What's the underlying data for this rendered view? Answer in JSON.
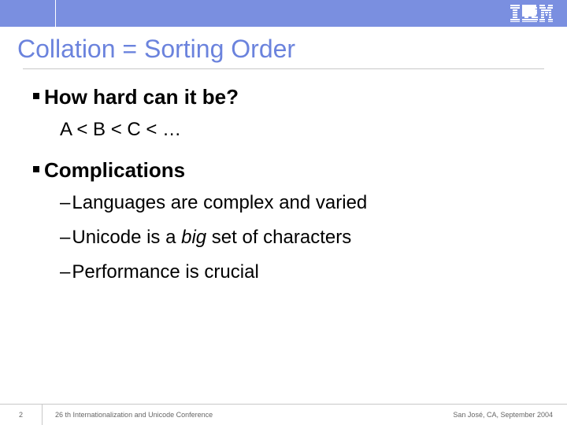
{
  "header": {
    "logo_name": "ibm-logo"
  },
  "title": "Collation = Sorting Order",
  "bullets": {
    "b1": {
      "heading": "How hard can it be?",
      "sub": "A < B < C < …"
    },
    "b2": {
      "heading": "Complications",
      "items": [
        "Languages are complex and varied",
        "Unicode is a ",
        " set of characters",
        "Performance is crucial"
      ],
      "big_word": "big"
    }
  },
  "footer": {
    "page": "2",
    "conference": "26 th Internationalization and Unicode Conference",
    "location": "San José, CA, September 2004"
  }
}
